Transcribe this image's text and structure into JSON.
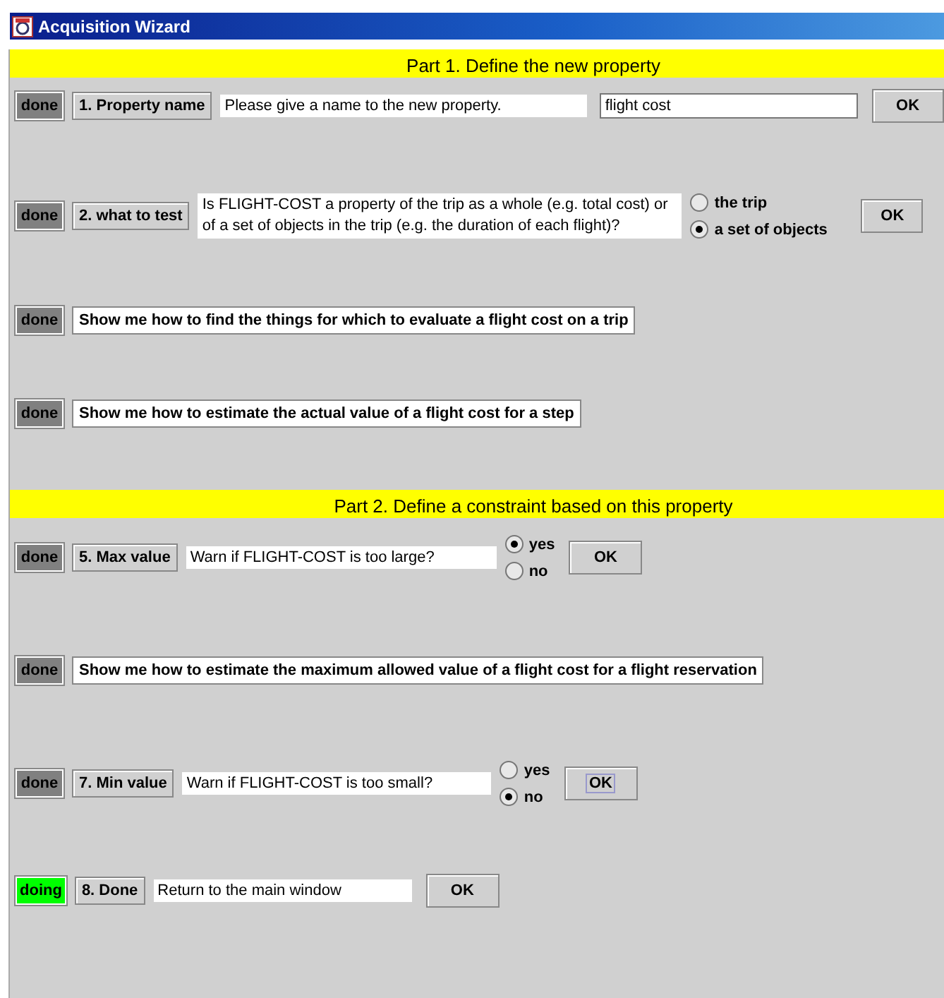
{
  "window": {
    "title": "Acquisition Wizard"
  },
  "parts": [
    {
      "title": "Part 1. Define the new property",
      "steps": [
        {
          "kind": "input",
          "status": "done",
          "color": "#808080",
          "label": "1. Property name",
          "prompt": "Please give a name to the new property.",
          "value": "flight cost",
          "ok": {
            "label": "OK",
            "focused": false
          }
        },
        {
          "kind": "choice",
          "status": "done",
          "color": "#808080",
          "label": "2. what to test",
          "prompt": "Is FLIGHT-COST a property of the trip as a whole (e.g. total cost) or of a set of objects in the trip (e.g. the duration of each flight)?",
          "options": [
            {
              "label": "the trip",
              "selected": false
            },
            {
              "label": "a set of objects",
              "selected": true
            }
          ],
          "ok": {
            "label": "OK",
            "focused": false
          }
        },
        {
          "kind": "link",
          "status": "done",
          "color": "#808080",
          "prompt": "Show me how to find the things for which to evaluate a flight cost on a trip"
        },
        {
          "kind": "link",
          "status": "done",
          "color": "#808080",
          "prompt": "Show me how to estimate the actual value of a flight cost for a step"
        }
      ]
    },
    {
      "title": "Part 2. Define a constraint based on this property",
      "steps": [
        {
          "kind": "choice",
          "status": "done",
          "color": "#808080",
          "label": "5. Max value",
          "prompt": "Warn if FLIGHT-COST is too large?",
          "options": [
            {
              "label": "yes",
              "selected": true
            },
            {
              "label": "no",
              "selected": false
            }
          ],
          "ok": {
            "label": "OK",
            "focused": false
          }
        },
        {
          "kind": "link",
          "status": "done",
          "color": "#808080",
          "prompt": "Show me how to estimate the maximum allowed value of a flight cost for a flight reservation"
        },
        {
          "kind": "choice",
          "status": "done",
          "color": "#808080",
          "label": "7. Min value",
          "prompt": "Warn if FLIGHT-COST is too small?",
          "options": [
            {
              "label": "yes",
              "selected": false
            },
            {
              "label": "no",
              "selected": true
            }
          ],
          "ok": {
            "label": "OK",
            "focused": true
          }
        },
        {
          "kind": "input",
          "status": "doing",
          "color": "#00ff00",
          "label": "8. Done",
          "prompt": "Return to the main window",
          "ok": {
            "label": "OK",
            "focused": false
          }
        }
      ]
    }
  ]
}
